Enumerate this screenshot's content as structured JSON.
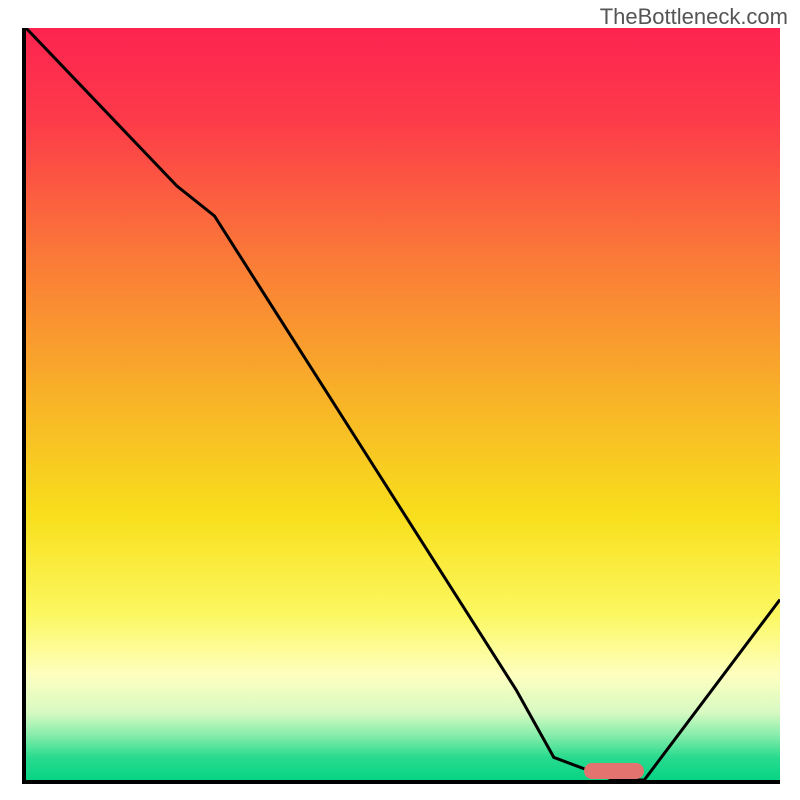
{
  "watermark": "TheBottleneck.com",
  "chart_data": {
    "type": "line",
    "title": "",
    "xlabel": "",
    "ylabel": "",
    "xlim": [
      0,
      100
    ],
    "ylim": [
      0,
      100
    ],
    "series": [
      {
        "name": "bottleneck-curve",
        "x": [
          0,
          20,
          25,
          65,
          70,
          78,
          82,
          100
        ],
        "values": [
          100,
          79,
          75,
          12,
          3,
          0,
          0,
          24
        ]
      }
    ],
    "marker": {
      "name": "optimal-range",
      "x_start": 74,
      "x_end": 82,
      "y": 1.2,
      "color": "#e2736e"
    },
    "gradient_stops": [
      {
        "offset": 0,
        "color": "#fd2450"
      },
      {
        "offset": 12,
        "color": "#fd3a4a"
      },
      {
        "offset": 30,
        "color": "#fa7838"
      },
      {
        "offset": 50,
        "color": "#f8b527"
      },
      {
        "offset": 65,
        "color": "#f8df1c"
      },
      {
        "offset": 78,
        "color": "#fcf861"
      },
      {
        "offset": 86,
        "color": "#feffbf"
      },
      {
        "offset": 91,
        "color": "#d7fac2"
      },
      {
        "offset": 94,
        "color": "#88edac"
      },
      {
        "offset": 97,
        "color": "#29db8e"
      },
      {
        "offset": 100,
        "color": "#07d484"
      }
    ]
  }
}
